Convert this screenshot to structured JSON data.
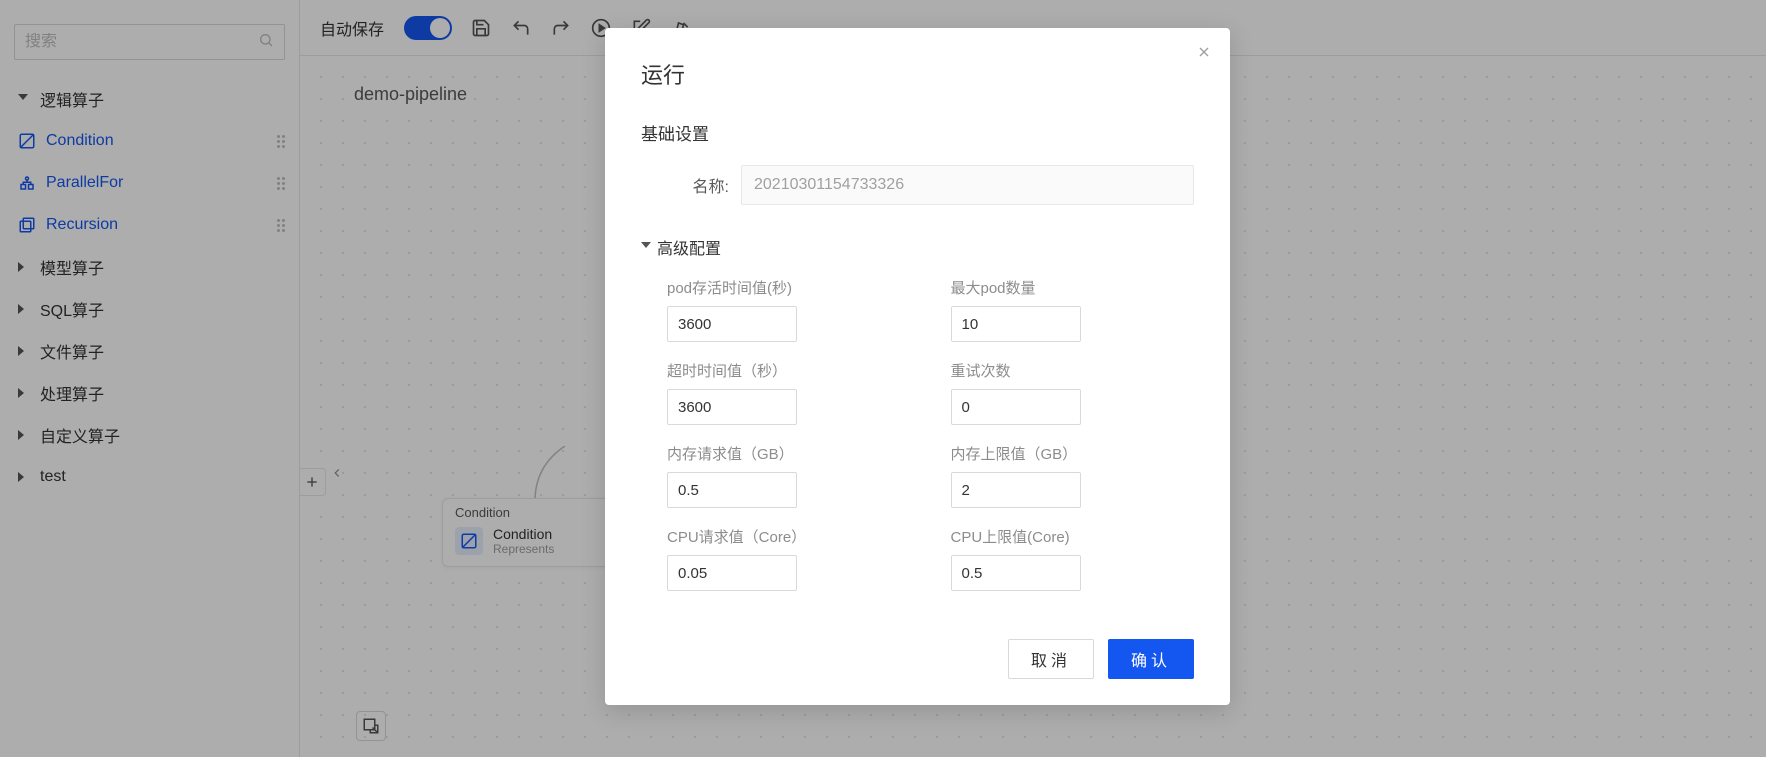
{
  "sidebar": {
    "search_placeholder": "搜索",
    "groups": [
      {
        "label": "逻辑算子",
        "expanded": true,
        "items": [
          {
            "label": "Condition",
            "icon": "condition-icon"
          },
          {
            "label": "ParallelFor",
            "icon": "parallel-icon"
          },
          {
            "label": "Recursion",
            "icon": "recursion-icon"
          }
        ]
      },
      {
        "label": "模型算子",
        "expanded": false
      },
      {
        "label": "SQL算子",
        "expanded": false
      },
      {
        "label": "文件算子",
        "expanded": false
      },
      {
        "label": "处理算子",
        "expanded": false
      },
      {
        "label": "自定义算子",
        "expanded": false
      },
      {
        "label": "test",
        "expanded": false
      }
    ]
  },
  "toolbar": {
    "autosave_label": "自动保存"
  },
  "canvas": {
    "pipeline_title": "demo-pipeline",
    "node": {
      "header": "Condition",
      "title": "Condition",
      "subtitle": "Represents"
    }
  },
  "modal": {
    "title": "运行",
    "section_basic": "基础设置",
    "name_label": "名称:",
    "name_value": "20210301154733326",
    "adv_label": "高级配置",
    "fields": {
      "pod_ttl": {
        "label": "pod存活时间值(秒)",
        "value": "3600"
      },
      "max_pods": {
        "label": "最大pod数量",
        "value": "10"
      },
      "timeout": {
        "label": "超时时间值（秒）",
        "value": "3600"
      },
      "retry": {
        "label": "重试次数",
        "value": "0"
      },
      "mem_req": {
        "label": "内存请求值（GB）",
        "value": "0.5"
      },
      "mem_lim": {
        "label": "内存上限值（GB）",
        "value": "2"
      },
      "cpu_req": {
        "label": "CPU请求值（Core）",
        "value": "0.05"
      },
      "cpu_lim": {
        "label": "CPU上限值(Core)",
        "value": "0.5"
      }
    },
    "cancel": "取消",
    "confirm": "确认"
  }
}
